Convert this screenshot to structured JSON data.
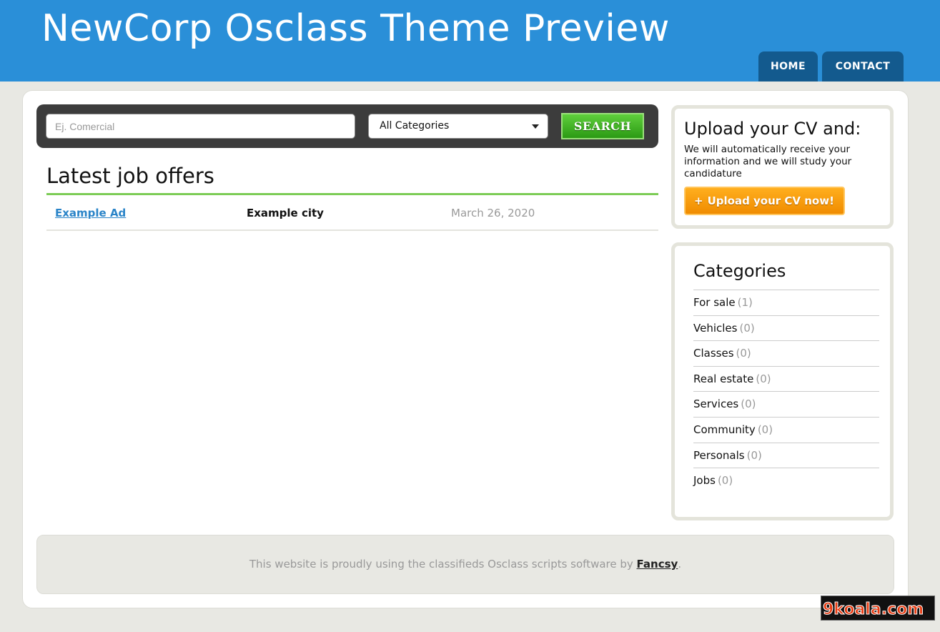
{
  "header": {
    "title": "NewCorp Osclass Theme Preview",
    "nav": [
      {
        "label": "HOME"
      },
      {
        "label": "CONTACT"
      }
    ]
  },
  "search": {
    "placeholder": "Ej. Comercial",
    "category_selected": "All Categories",
    "button_label": "SEARCH"
  },
  "latest": {
    "title": "Latest job offers",
    "offers": [
      {
        "title": "Example Ad",
        "city": "Example city",
        "date": "March 26, 2020"
      }
    ]
  },
  "cv": {
    "title": "Upload your CV and:",
    "text": "We will automatically receive your information and we will study your candidature",
    "button_icon": "plus-icon",
    "button_label": "Upload your CV now!"
  },
  "categories": {
    "title": "Categories",
    "items": [
      {
        "name": "For sale",
        "count": "(1)"
      },
      {
        "name": "Vehicles",
        "count": "(0)"
      },
      {
        "name": "Classes",
        "count": "(0)"
      },
      {
        "name": "Real estate",
        "count": "(0)"
      },
      {
        "name": "Services",
        "count": "(0)"
      },
      {
        "name": "Community",
        "count": "(0)"
      },
      {
        "name": "Personals",
        "count": "(0)"
      },
      {
        "name": "Jobs",
        "count": "(0)"
      }
    ]
  },
  "footer": {
    "text_before": "This website is proudly using the classifieds Osclass scripts software by ",
    "link": "Fancsy",
    "text_after": "."
  },
  "watermark": {
    "text": "9koala.com"
  },
  "colors": {
    "header_blue": "#2a8fd8",
    "nav_dark_blue": "#135a8e",
    "search_green": "#3aa81e",
    "accent_green_rule": "#7ccc56",
    "cv_orange": "#f5980a",
    "link_blue": "#2a84c8"
  }
}
